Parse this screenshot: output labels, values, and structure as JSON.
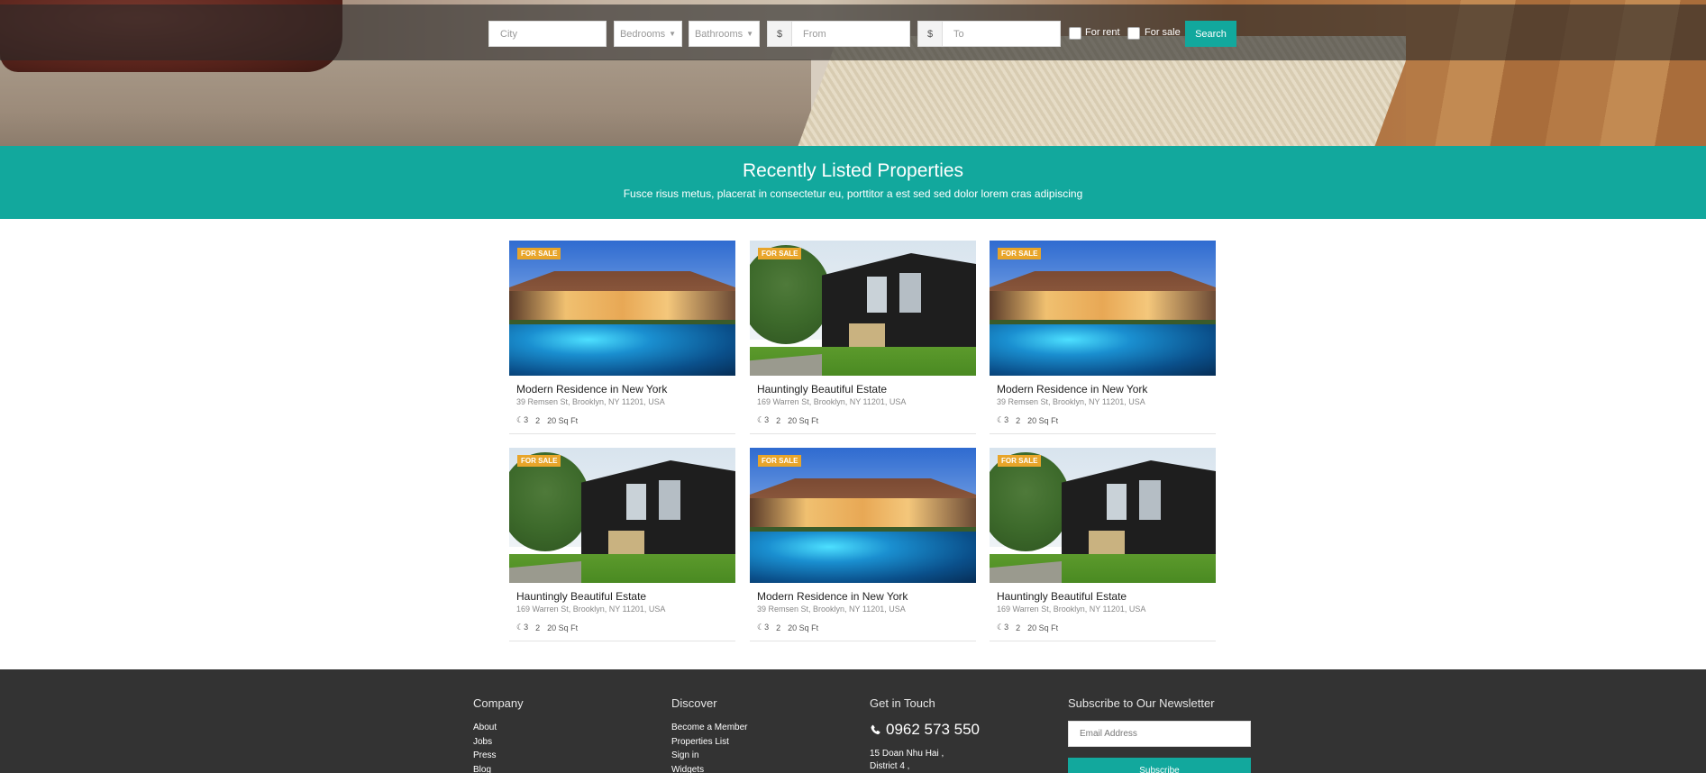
{
  "search": {
    "city_placeholder": "City",
    "bedrooms_label": "Bedrooms",
    "bathrooms_label": "Bathrooms",
    "currency_symbol": "$",
    "from_placeholder": "From",
    "to_placeholder": "To",
    "for_rent_label": "For rent",
    "for_sale_label": "For sale",
    "search_button": "Search"
  },
  "section": {
    "title": "Recently Listed Properties",
    "subtitle": "Fusce risus metus, placerat in consectetur eu, porttitor a est sed sed dolor lorem cras adipiscing"
  },
  "listings": [
    {
      "badge": "FOR SALE",
      "title": "Modern Residence in New York",
      "address": "39 Remsen St, Brooklyn, NY 11201, USA",
      "beds": "3",
      "baths": "2",
      "area": "20 Sq Ft",
      "photo": "pool-house"
    },
    {
      "badge": "FOR SALE",
      "title": "Hauntingly Beautiful Estate",
      "address": "169 Warren St, Brooklyn, NY 11201, USA",
      "beds": "3",
      "baths": "2",
      "area": "20 Sq Ft",
      "photo": "black-house"
    },
    {
      "badge": "FOR SALE",
      "title": "Modern Residence in New York",
      "address": "39 Remsen St, Brooklyn, NY 11201, USA",
      "beds": "3",
      "baths": "2",
      "area": "20 Sq Ft",
      "photo": "pool-house"
    },
    {
      "badge": "FOR SALE",
      "title": "Hauntingly Beautiful Estate",
      "address": "169 Warren St, Brooklyn, NY 11201, USA",
      "beds": "3",
      "baths": "2",
      "area": "20 Sq Ft",
      "photo": "black-house"
    },
    {
      "badge": "FOR SALE",
      "title": "Modern Residence in New York",
      "address": "39 Remsen St, Brooklyn, NY 11201, USA",
      "beds": "3",
      "baths": "2",
      "area": "20 Sq Ft",
      "photo": "pool-house"
    },
    {
      "badge": "FOR SALE",
      "title": "Hauntingly Beautiful Estate",
      "address": "169 Warren St, Brooklyn, NY 11201, USA",
      "beds": "3",
      "baths": "2",
      "area": "20 Sq Ft",
      "photo": "black-house"
    }
  ],
  "footer": {
    "company": {
      "heading": "Company",
      "links": [
        "About",
        "Jobs",
        "Press",
        "Blog"
      ]
    },
    "discover": {
      "heading": "Discover",
      "links": [
        "Become a Member",
        "Properties List",
        "Sign in",
        "Widgets"
      ]
    },
    "contact": {
      "heading": "Get in Touch",
      "phone": "0962 573 550",
      "address_lines": [
        "15 Doan Nhu Hai ,",
        "District 4 ,"
      ]
    },
    "newsletter": {
      "heading": "Subscribe to Our Newsletter",
      "email_placeholder": "Email Address",
      "button": "Subscribe"
    }
  },
  "colors": {
    "accent": "#12a89d",
    "badge": "#e8a52a",
    "footer_bg": "#333333"
  },
  "icons": {
    "bed": "moon-icon",
    "phone": "phone-icon"
  }
}
